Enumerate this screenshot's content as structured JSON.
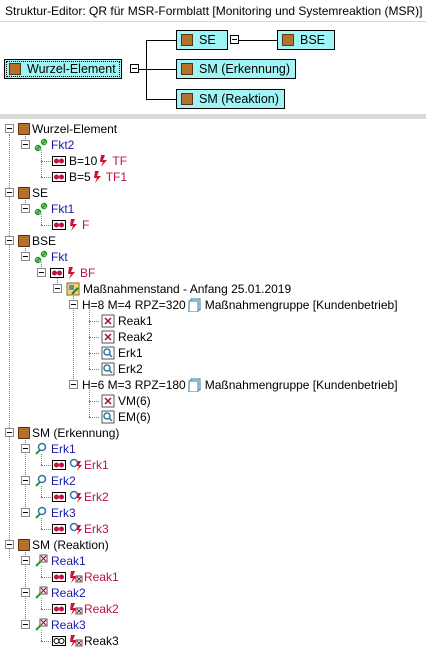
{
  "window": {
    "title": "Struktur-Editor: QR für MSR-Formblatt [Monitoring und Systemreaktion (MSR)]"
  },
  "diagram": {
    "root": "Wurzel-Element",
    "se": "SE",
    "bse": "BSE",
    "sm_erkennung": "SM (Erkennung)",
    "sm_reaktion": "SM (Reaktion)"
  },
  "tree": {
    "root": "Wurzel-Element",
    "fkt2": "Fkt2",
    "b10": "B=10",
    "tf": "TF",
    "b5": "B=5",
    "tf1": "TF1",
    "se": "SE",
    "fkt1": "Fkt1",
    "f": "F",
    "bse": "BSE",
    "fkt": "Fkt",
    "bf": "BF",
    "massnahmenstand": "Maßnahmenstand - Anfang 25.01.2019",
    "group1": "H=8 M=4 RPZ=320",
    "group1_label": "Maßnahmengruppe [Kundenbetrieb]",
    "reak1": "Reak1",
    "reak2": "Reak2",
    "erk1": "Erk1",
    "erk2": "Erk2",
    "group2": "H=6 M=3 RPZ=180",
    "group2_label": "Maßnahmengruppe [Kundenbetrieb]",
    "vm6": "VM(6)",
    "em6": "EM(6)",
    "sm_erk": "SM (Erkennung)",
    "erk1_node": "Erk1",
    "erk1_child": "Erk1",
    "erk2_node": "Erk2",
    "erk2_child": "Erk2",
    "erk3_node": "Erk3",
    "erk3_child": "Erk3",
    "sm_reak": "SM (Reaktion)",
    "reak1_node": "Reak1",
    "reak1_child": "Reak1",
    "reak2_node": "Reak2",
    "reak2_child": "Reak2",
    "reak3_node": "Reak3",
    "reak3_child": "Reak3"
  },
  "colors": {
    "node_fill": "#9ff5f6",
    "structure_icon": "#b5702c",
    "function_text": "#1a1aa6",
    "failure_text": "#c0103c"
  },
  "icons": {
    "structure": "structure-element-icon",
    "function": "function-link-icon",
    "failure": "failure-bolt-icon",
    "measure": "measure-state-icon",
    "group": "document-group-icon"
  }
}
